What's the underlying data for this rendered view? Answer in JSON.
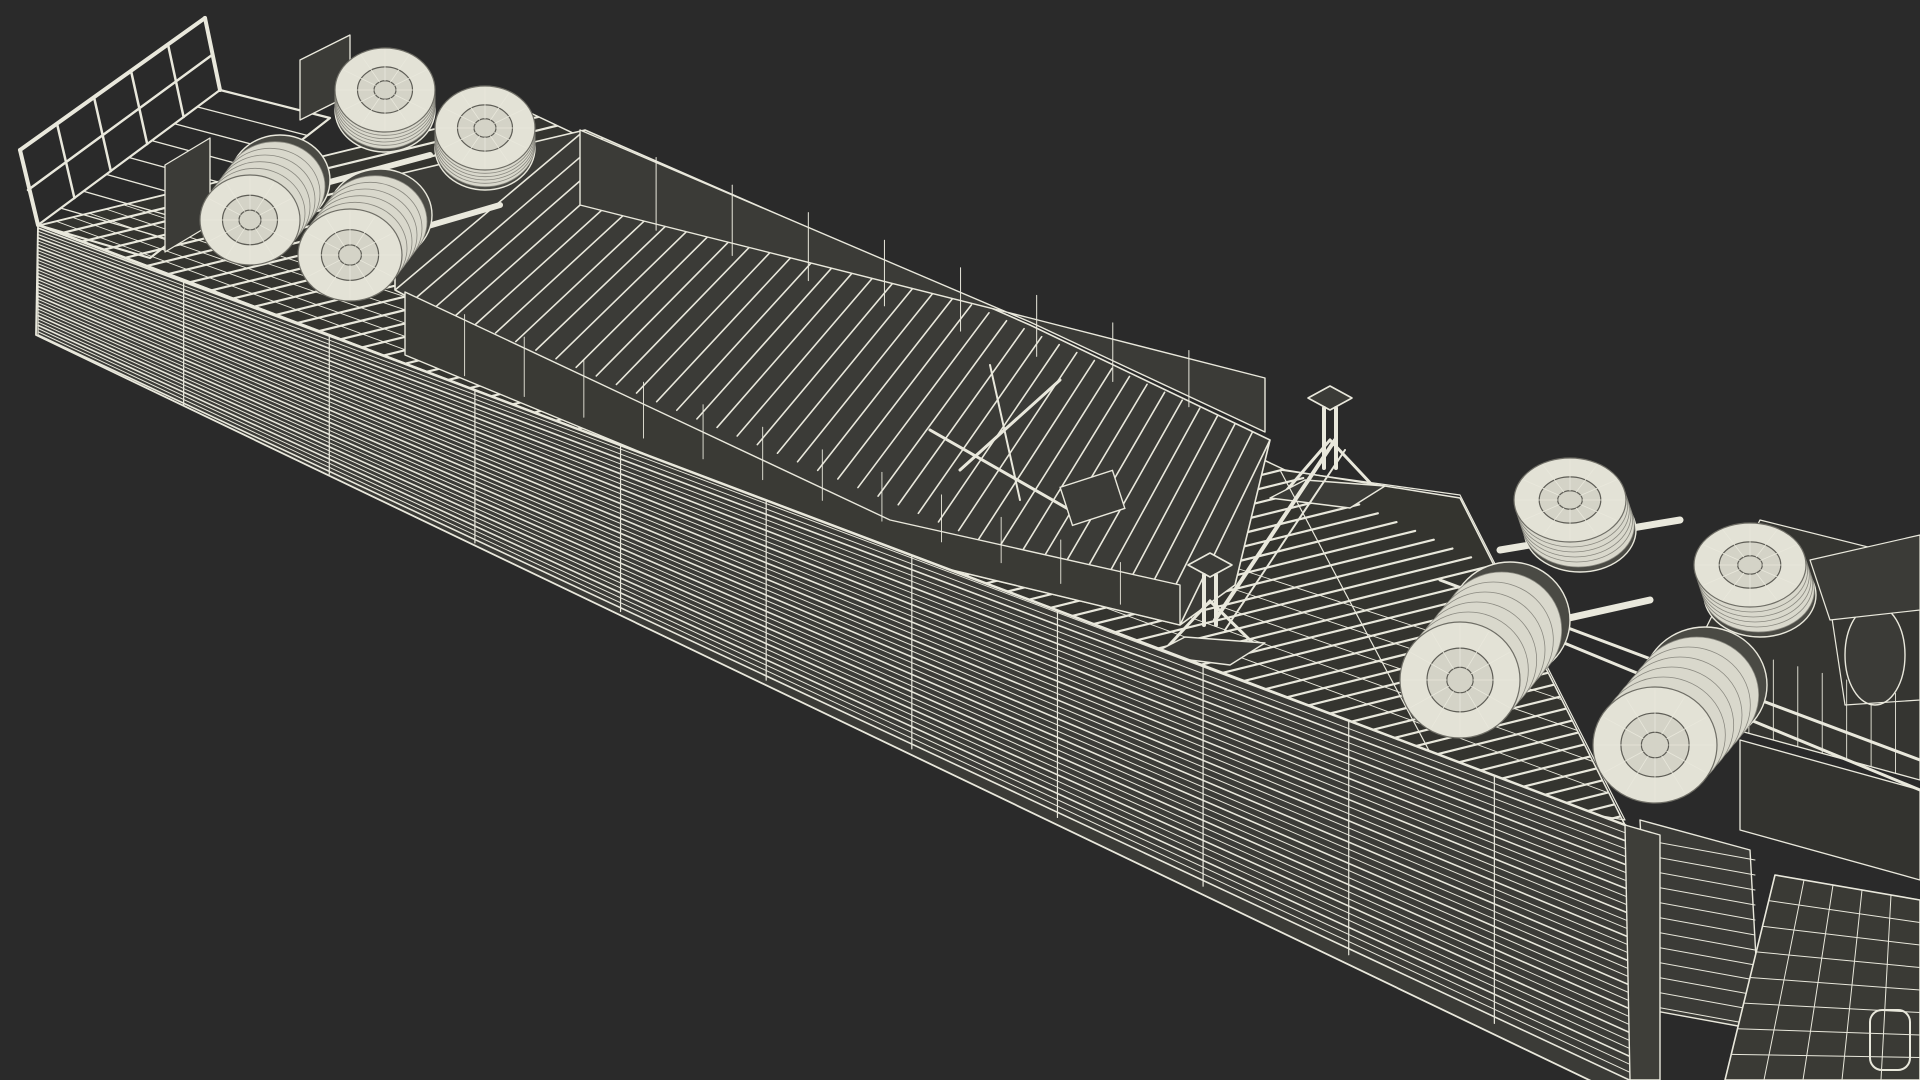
{
  "scene": {
    "subject": "wireframe-render",
    "colors": {
      "background": "#2a2a2a",
      "wire": "#e9e8dc",
      "wire_dim": "#b9b8ad",
      "panel_fill": "#3b3b37",
      "deck_fill": "#34342f"
    },
    "components": [
      "trailer-side-wall",
      "trailer-deck",
      "rear-railing",
      "rear-axle-wheels",
      "inner-ramp",
      "landing-legs",
      "truck-wheels",
      "truck-chassis",
      "truck-cab"
    ]
  }
}
